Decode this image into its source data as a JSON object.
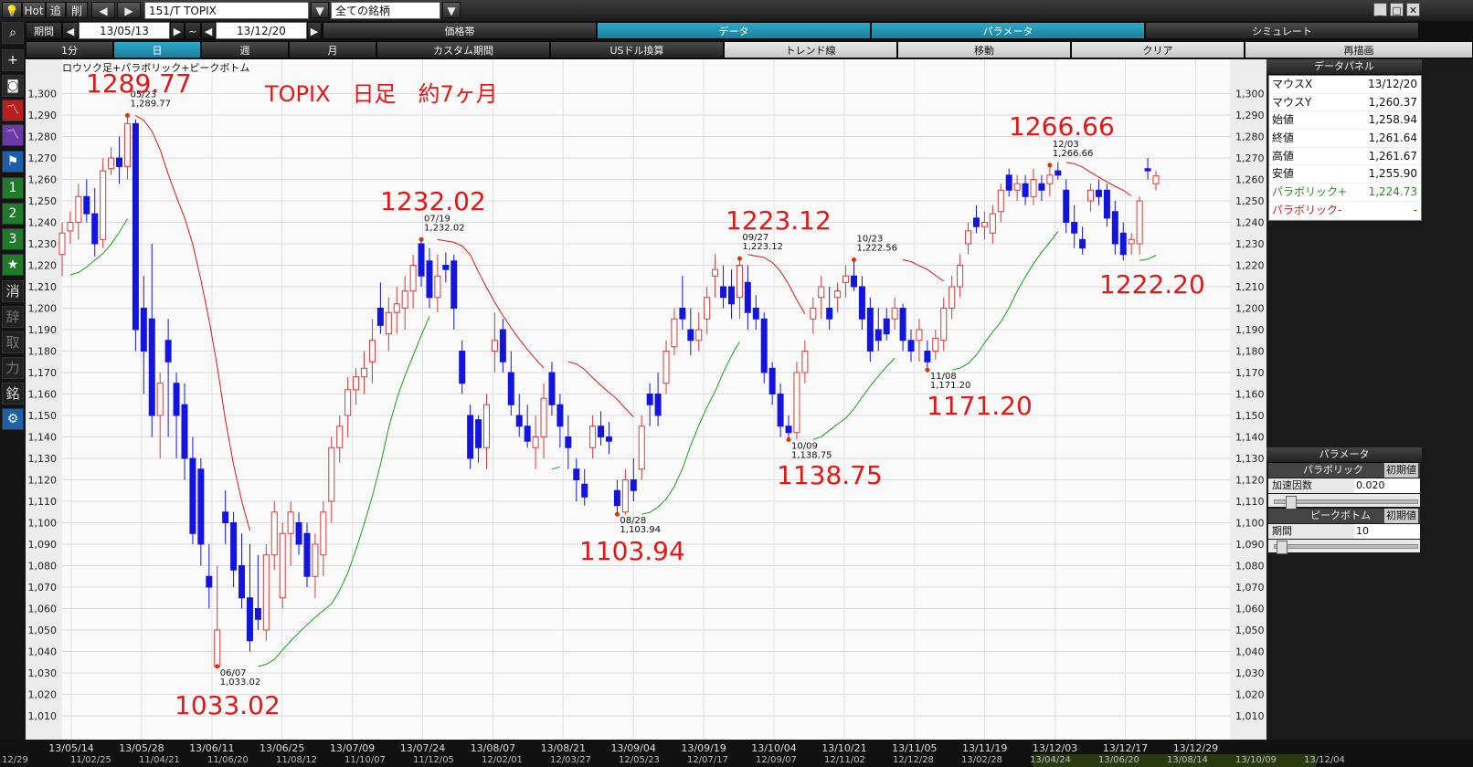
{
  "toolbar": {
    "hot": "Hot",
    "add": "追",
    "del": "削",
    "symbol": "151/T TOPIX",
    "universe": "全ての銘柄",
    "period_label": "期間",
    "date_from": "13/05/13",
    "tilde": "~",
    "date_to": "13/12/20",
    "prev": "◀",
    "next": "▶",
    "dropdown": "▼",
    "win_min": "_",
    "win_max": "□",
    "win_close": "✕"
  },
  "tabs_row1": [
    "価格帯",
    "データ",
    "パラメータ",
    "シミュレート"
  ],
  "tabs_row2": [
    "1分",
    "日",
    "週",
    "月",
    "カスタム期間",
    "USドル換算",
    "トレンド線",
    "移動",
    "クリア",
    "再描画"
  ],
  "sidebar": {
    "icons": [
      "search-icon",
      "add-icon",
      "camera-icon",
      "chart-red-icon",
      "chart-purple-icon",
      "flag-icon",
      "1",
      "2",
      "3",
      "star-icon",
      "消",
      "辞",
      "取",
      "力",
      "銘",
      "gear-icon"
    ]
  },
  "chart_data": {
    "type": "candlestick",
    "title": "ロウソク足+パラボリック+ピークボトム",
    "annotation_title": "TOPIX　日足　約7ヶ月",
    "ylim": [
      1010,
      1305
    ],
    "yticks": [
      "1,300",
      "1,290",
      "1,280",
      "1,270",
      "1,260",
      "1,250",
      "1,240",
      "1,230",
      "1,220",
      "1,210",
      "1,200",
      "1,190",
      "1,180",
      "1,170",
      "1,160",
      "1,150",
      "1,140",
      "1,130",
      "1,120",
      "1,110",
      "1,100",
      "1,090",
      "1,080",
      "1,070",
      "1,060",
      "1,050",
      "1,040",
      "1,030",
      "1,020",
      "1,010"
    ],
    "xticks": [
      "13/05/14",
      "13/05/28",
      "13/06/11",
      "13/06/25",
      "13/07/09",
      "13/07/24",
      "13/08/07",
      "13/08/21",
      "13/09/04",
      "13/09/19",
      "13/10/04",
      "13/10/21",
      "13/11/05",
      "13/11/19",
      "13/12/03",
      "13/12/17",
      "13/12/29"
    ],
    "colors": {
      "up": "#d83a3a",
      "down": "#1414e0",
      "sar_up": "#1e9e1e",
      "sar_down": "#e01818",
      "peak": "#e03000",
      "bottom": "#e03000",
      "annot": "#e01818"
    },
    "candles": [
      [
        1225,
        1240,
        1215,
        1235
      ],
      [
        1236,
        1245,
        1230,
        1240
      ],
      [
        1240,
        1258,
        1232,
        1252
      ],
      [
        1252,
        1260,
        1240,
        1244
      ],
      [
        1244,
        1256,
        1224,
        1230
      ],
      [
        1232,
        1270,
        1228,
        1264
      ],
      [
        1265,
        1275,
        1262,
        1270
      ],
      [
        1270,
        1280,
        1258,
        1266
      ],
      [
        1266,
        1289.77,
        1260,
        1286
      ],
      [
        1286,
        1288,
        1180,
        1190
      ],
      [
        1200,
        1215,
        1160,
        1180
      ],
      [
        1195,
        1230,
        1140,
        1150
      ],
      [
        1150,
        1170,
        1130,
        1165
      ],
      [
        1185,
        1195,
        1140,
        1175
      ],
      [
        1165,
        1170,
        1130,
        1150
      ],
      [
        1155,
        1165,
        1120,
        1130
      ],
      [
        1130,
        1140,
        1090,
        1095
      ],
      [
        1125,
        1130,
        1080,
        1090
      ],
      [
        1075,
        1090,
        1060,
        1070
      ],
      [
        1033.02,
        1080,
        1033.02,
        1050
      ],
      [
        1105,
        1115,
        1090,
        1100
      ],
      [
        1100,
        1105,
        1070,
        1078
      ],
      [
        1080,
        1095,
        1060,
        1065
      ],
      [
        1065,
        1090,
        1040,
        1045
      ],
      [
        1060,
        1085,
        1050,
        1055
      ],
      [
        1050,
        1090,
        1045,
        1085
      ],
      [
        1085,
        1110,
        1078,
        1105
      ],
      [
        1065,
        1100,
        1060,
        1095
      ],
      [
        1095,
        1110,
        1080,
        1105
      ],
      [
        1100,
        1105,
        1085,
        1090
      ],
      [
        1095,
        1100,
        1070,
        1075
      ],
      [
        1075,
        1095,
        1065,
        1090
      ],
      [
        1085,
        1110,
        1075,
        1105
      ],
      [
        1110,
        1140,
        1100,
        1135
      ],
      [
        1135,
        1150,
        1128,
        1145
      ],
      [
        1150,
        1168,
        1140,
        1162
      ],
      [
        1162,
        1172,
        1155,
        1168
      ],
      [
        1168,
        1180,
        1160,
        1172
      ],
      [
        1175,
        1195,
        1165,
        1185
      ],
      [
        1200,
        1212,
        1188,
        1192
      ],
      [
        1188,
        1205,
        1180,
        1198
      ],
      [
        1198,
        1210,
        1188,
        1202
      ],
      [
        1200,
        1215,
        1190,
        1208
      ],
      [
        1208,
        1225,
        1200,
        1220
      ],
      [
        1230,
        1232.02,
        1210,
        1215
      ],
      [
        1222,
        1228,
        1200,
        1205
      ],
      [
        1205,
        1225,
        1198,
        1215
      ],
      [
        1220,
        1226,
        1212,
        1218
      ],
      [
        1222,
        1225,
        1190,
        1200
      ],
      [
        1180,
        1185,
        1160,
        1165
      ],
      [
        1150,
        1155,
        1125,
        1130
      ],
      [
        1148,
        1150,
        1128,
        1135
      ],
      [
        1135,
        1160,
        1125,
        1155
      ],
      [
        1180,
        1198,
        1170,
        1185
      ],
      [
        1190,
        1195,
        1170,
        1175
      ],
      [
        1170,
        1180,
        1150,
        1155
      ],
      [
        1150,
        1160,
        1140,
        1145
      ],
      [
        1145,
        1155,
        1135,
        1138
      ],
      [
        1135,
        1150,
        1125,
        1140
      ],
      [
        1140,
        1165,
        1130,
        1158
      ],
      [
        1170,
        1175,
        1150,
        1155
      ],
      [
        1155,
        1160,
        1135,
        1145
      ],
      [
        1140,
        1150,
        1125,
        1135
      ],
      [
        1125,
        1130,
        1110,
        1120
      ],
      [
        1118,
        1125,
        1108,
        1112
      ],
      [
        1135,
        1150,
        1130,
        1145
      ],
      [
        1145,
        1152,
        1136,
        1140
      ],
      [
        1140,
        1147,
        1132,
        1138
      ],
      [
        1115,
        1120,
        1103.94,
        1108
      ],
      [
        1105,
        1125,
        1103.94,
        1120
      ],
      [
        1120,
        1130,
        1110,
        1115
      ],
      [
        1125,
        1150,
        1120,
        1145
      ],
      [
        1160,
        1165,
        1145,
        1155
      ],
      [
        1160,
        1170,
        1145,
        1150
      ],
      [
        1165,
        1185,
        1160,
        1180
      ],
      [
        1182,
        1200,
        1178,
        1195
      ],
      [
        1200,
        1215,
        1190,
        1195
      ],
      [
        1190,
        1200,
        1178,
        1185
      ],
      [
        1185,
        1198,
        1180,
        1190
      ],
      [
        1195,
        1210,
        1188,
        1205
      ],
      [
        1215,
        1225,
        1205,
        1218
      ],
      [
        1210,
        1220,
        1200,
        1205
      ],
      [
        1210,
        1218,
        1195,
        1202
      ],
      [
        1205,
        1223.12,
        1195,
        1220
      ],
      [
        1212,
        1220,
        1190,
        1198
      ],
      [
        1200,
        1206,
        1190,
        1195
      ],
      [
        1195,
        1198,
        1165,
        1170
      ],
      [
        1172,
        1175,
        1155,
        1160
      ],
      [
        1160,
        1165,
        1140,
        1145
      ],
      [
        1145,
        1150,
        1138.75,
        1142
      ],
      [
        1142,
        1175,
        1138.75,
        1170
      ],
      [
        1170,
        1185,
        1165,
        1180
      ],
      [
        1195,
        1205,
        1188,
        1200
      ],
      [
        1205,
        1215,
        1195,
        1210
      ],
      [
        1200,
        1210,
        1190,
        1195
      ],
      [
        1205,
        1212,
        1198,
        1208
      ],
      [
        1212,
        1220,
        1205,
        1215
      ],
      [
        1215,
        1222.56,
        1208,
        1210
      ],
      [
        1210,
        1215,
        1190,
        1195
      ],
      [
        1200,
        1205,
        1175,
        1180
      ],
      [
        1190,
        1200,
        1180,
        1185
      ],
      [
        1195,
        1200,
        1185,
        1188
      ],
      [
        1195,
        1205,
        1190,
        1200
      ],
      [
        1200,
        1202,
        1180,
        1185
      ],
      [
        1185,
        1190,
        1175,
        1180
      ],
      [
        1185,
        1195,
        1175,
        1190
      ],
      [
        1180,
        1185,
        1171.2,
        1175
      ],
      [
        1180,
        1190,
        1176,
        1186
      ],
      [
        1185,
        1205,
        1180,
        1200
      ],
      [
        1200,
        1215,
        1195,
        1210
      ],
      [
        1210,
        1225,
        1205,
        1220
      ],
      [
        1230,
        1240,
        1225,
        1236
      ],
      [
        1242,
        1248,
        1235,
        1238
      ],
      [
        1238,
        1245,
        1232,
        1240
      ],
      [
        1235,
        1248,
        1230,
        1244
      ],
      [
        1245,
        1258,
        1240,
        1255
      ],
      [
        1262,
        1265,
        1252,
        1255
      ],
      [
        1255,
        1262,
        1250,
        1258
      ],
      [
        1258,
        1262,
        1248,
        1252
      ],
      [
        1252,
        1265,
        1248,
        1260
      ],
      [
        1258,
        1262,
        1250,
        1255
      ],
      [
        1258,
        1266.66,
        1252,
        1262
      ],
      [
        1264,
        1268,
        1260,
        1262
      ],
      [
        1255,
        1260,
        1235,
        1240
      ],
      [
        1240,
        1248,
        1228,
        1235
      ],
      [
        1232,
        1238,
        1225,
        1228
      ],
      [
        1250,
        1258,
        1245,
        1255
      ],
      [
        1255,
        1260,
        1248,
        1252
      ],
      [
        1255,
        1258,
        1238,
        1242
      ],
      [
        1245,
        1250,
        1225,
        1230
      ],
      [
        1235,
        1240,
        1222.2,
        1225
      ],
      [
        1230,
        1235,
        1225,
        1232
      ],
      [
        1230,
        1252,
        1225,
        1250
      ],
      [
        1265,
        1270,
        1260,
        1264
      ],
      [
        1258,
        1264,
        1255,
        1261.64
      ]
    ],
    "peaks": [
      {
        "date": "05/23",
        "value": "1,289.77",
        "big": "1289.77"
      },
      {
        "date": "07/19",
        "value": "1,232.02",
        "big": "1232.02"
      },
      {
        "date": "09/27",
        "value": "1,223.12",
        "big": "1223.12"
      },
      {
        "date": "10/23",
        "value": "1,222.56",
        "big": ""
      },
      {
        "date": "12/03",
        "value": "1,266.66",
        "big": "1266.66"
      }
    ],
    "bottoms": [
      {
        "date": "06/07",
        "value": "1,033.02",
        "big": "1033.02"
      },
      {
        "date": "08/28",
        "value": "1,103.94",
        "big": "1103.94"
      },
      {
        "date": "10/09",
        "value": "1,138.75",
        "big": "1138.75"
      },
      {
        "date": "11/08",
        "value": "1,171.20",
        "big": "1171.20"
      }
    ],
    "last_big": "1222.20"
  },
  "data_panel": {
    "title": "データパネル",
    "rows": [
      {
        "k": "マウスX",
        "v": "13/12/20"
      },
      {
        "k": "マウスY",
        "v": "1,260.37"
      },
      {
        "k": "始値",
        "v": "1,258.94"
      },
      {
        "k": "終値",
        "v": "1,261.64"
      },
      {
        "k": "高値",
        "v": "1,261.67"
      },
      {
        "k": "安値",
        "v": "1,255.90"
      },
      {
        "k": "パラボリック+",
        "v": "1,224.73"
      },
      {
        "k": "パラボリック-",
        "v": "-"
      }
    ]
  },
  "param_panel": {
    "title": "パラメータ",
    "parabolic": "パラボリック",
    "init": "初期値",
    "accel_label": "加速因数",
    "accel_value": "0.020",
    "peakbottom": "ピークボトム",
    "period_label": "期間",
    "period_value": "10"
  },
  "bottom_labels": [
    "12/29",
    "11/02/25",
    "11/04/21",
    "11/06/20",
    "11/08/12",
    "11/10/07",
    "11/12/05",
    "12/02/01",
    "12/03/27",
    "12/05/23",
    "12/07/17",
    "12/09/07",
    "12/11/02",
    "12/12/28",
    "13/02/28",
    "13/04/24",
    "13/06/20",
    "13/08/14",
    "13/10/09",
    "13/12/04"
  ]
}
